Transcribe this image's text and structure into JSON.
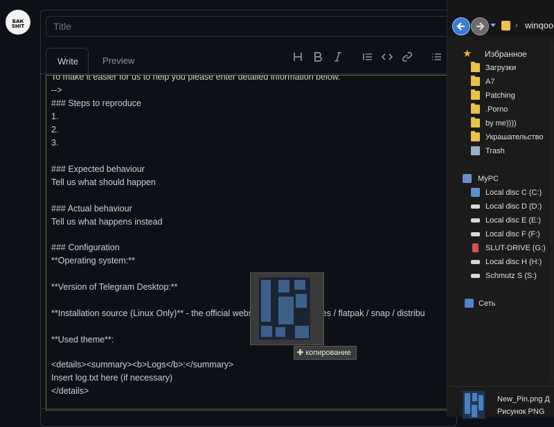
{
  "editor": {
    "title_placeholder": "Title",
    "tabs": {
      "write": "Write",
      "preview": "Preview"
    },
    "toolbar": [
      {
        "name": "heading-icon",
        "glyph": "H"
      },
      {
        "name": "bold-icon",
        "glyph": "B"
      },
      {
        "name": "italic-icon",
        "glyph": "I"
      },
      {
        "name": "quote-icon",
        "glyph": "quote"
      },
      {
        "name": "code-icon",
        "glyph": "code"
      },
      {
        "name": "link-icon",
        "glyph": "link"
      },
      {
        "name": "list-icon",
        "glyph": "list"
      }
    ],
    "lines": [
      "To make it easier for us to help you please enter detailed information below.",
      "-->",
      "### Steps to reproduce",
      "1.",
      "2.",
      "3.",
      "",
      "### Expected behaviour",
      "Tell us what should happen",
      "",
      "### Actual behaviour",
      "Tell us what happens instead",
      "",
      "### Configuration",
      "**Operating system:**",
      "",
      "**Version of Telegram Desktop:**",
      "",
      "**Installation source (Linux Only)** - the official website / GitHub releases / flatpak / snap / distribu",
      "",
      "**Used theme**:",
      "",
      "<details><summary><b>Logs</b>:</summary>",
      "Insert log.txt here (if necessary)",
      "</details>"
    ]
  },
  "drag": {
    "tooltip": "копирование",
    "tooltip_icon": "plus-icon"
  },
  "avatar": {
    "text_line1": "БАК",
    "text_line2": "SHIT"
  },
  "explorer": {
    "address": "winqoo",
    "favorites_label": "Избранное",
    "favorites": [
      "Загрузки",
      "A7",
      "Patching",
      ".Porno",
      "by me))))",
      "Украшательство",
      "Trash"
    ],
    "computer_label": "MyPC",
    "drives": [
      "Local disc C (C:)",
      "Local disc D (D:)",
      "Local disc E (E:)",
      "Local disc F (F:)",
      "SLUT-DRIVE (G:)",
      "Local disc H (H:)",
      "Schmutz S (S:)"
    ],
    "network_label": "Сеть",
    "details": {
      "file_name": "New_Pin.png",
      "file_name_suffix": "Д",
      "file_type": "Рисунок PNG"
    }
  },
  "colors": {
    "accent": "#3c7ad6",
    "folder": "#e8c24a",
    "editor_bg": "#0d1117",
    "focus_border": "#6b7a2a"
  }
}
